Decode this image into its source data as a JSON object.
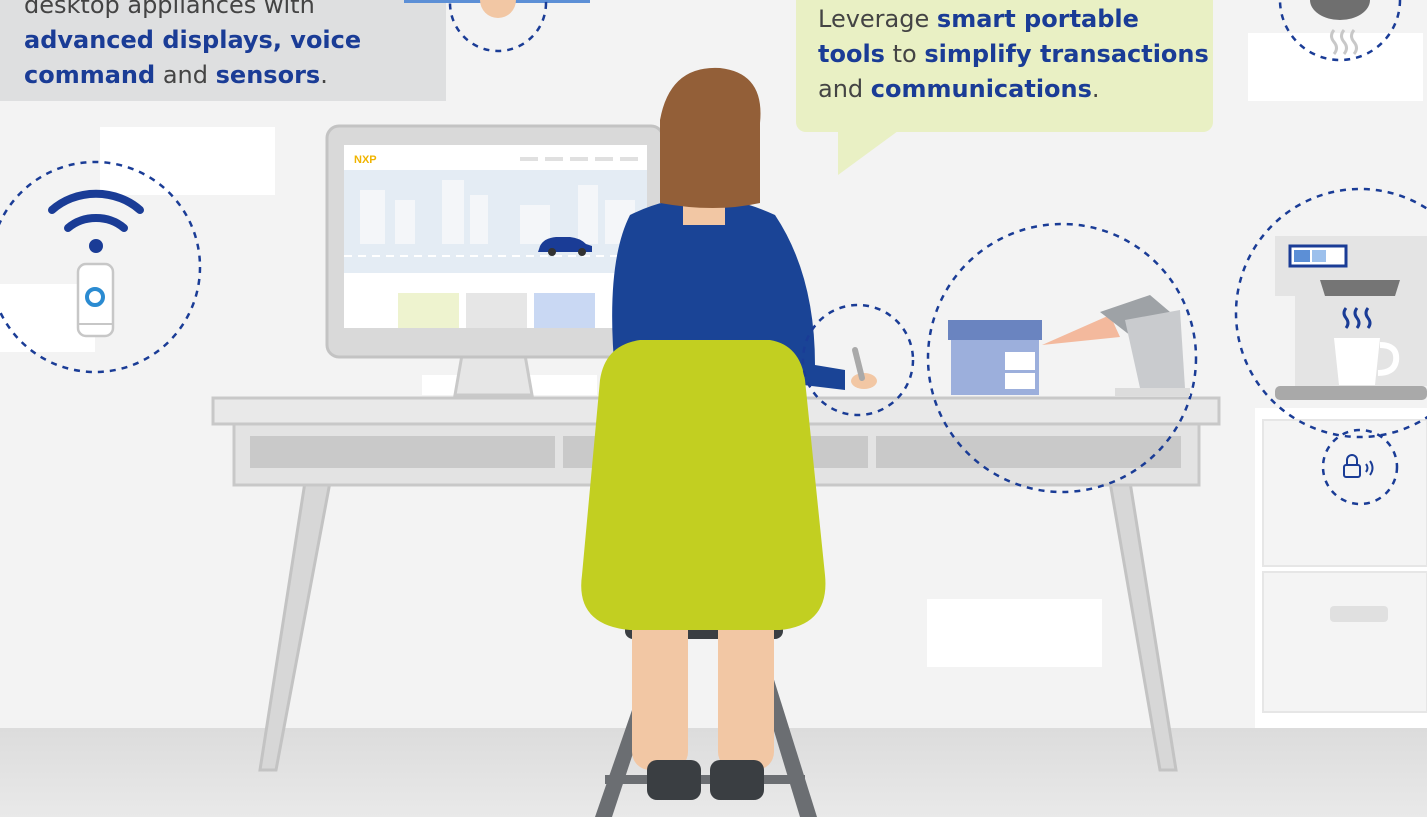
{
  "left_callout": {
    "line1": "desktop appliances with",
    "hl1": "advanced displays, voice",
    "hl2": "command",
    "and1": "and",
    "hl3": "sensors",
    "period": "."
  },
  "right_callout": {
    "word1": "Leverage",
    "hl1": "smart portable",
    "hl2": "tools",
    "word2": "to",
    "hl3": "simplify transactions",
    "word3": "and",
    "hl4": "communications",
    "period": "."
  },
  "monitor": {
    "logo": "NXP"
  },
  "colors": {
    "brand_blue": "#1a3c96",
    "chair_green": "#c2cf21",
    "hair_brown": "#935f38",
    "callout_green": "#e9f0c4",
    "callout_gray": "#dedfe0"
  },
  "icons": [
    "wifi-icon",
    "phone-icon",
    "stylus-icon",
    "barcode-scanner-icon",
    "coffee-machine-icon",
    "lock-icon",
    "steam-icon"
  ]
}
